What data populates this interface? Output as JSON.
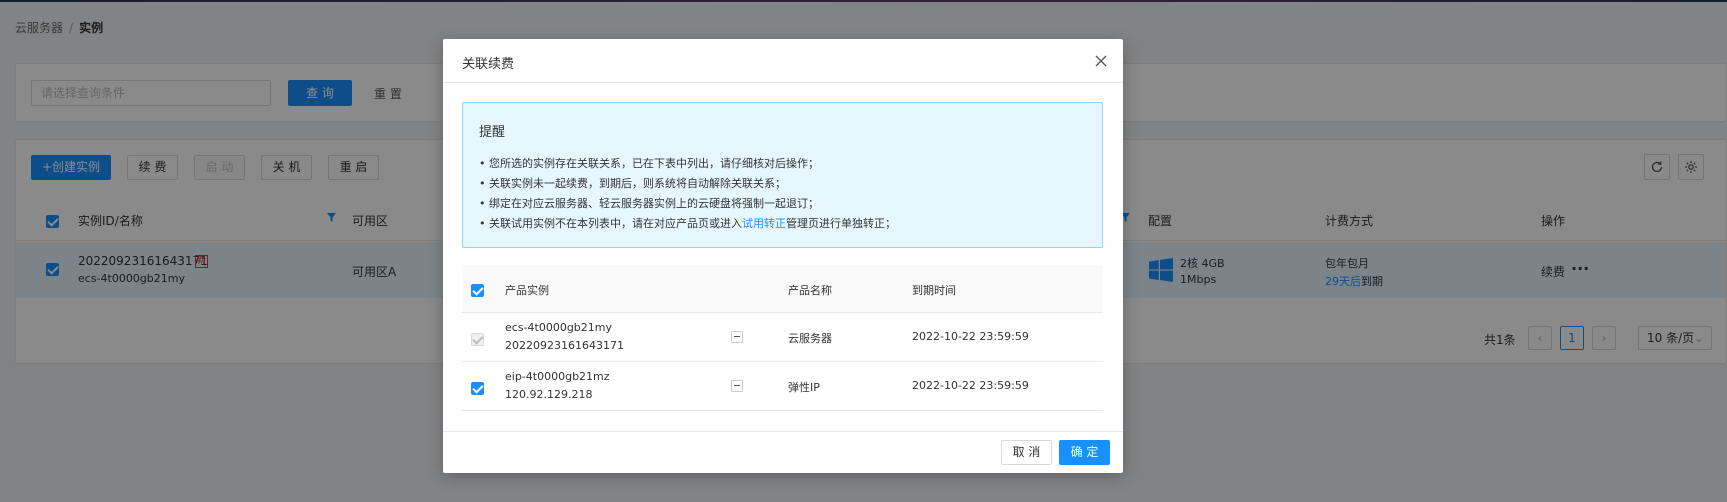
{
  "breadcrumb": {
    "parent": "云服务器",
    "separator": "/",
    "current": "实例"
  },
  "search": {
    "placeholder": "请选择查询条件",
    "query_label": "查 询",
    "reset_label": "重 置"
  },
  "toolbar": {
    "create_label": "+创建实例",
    "renew_label": "续 费",
    "start_label": "启 动",
    "shutdown_label": "关 机",
    "restart_label": "重 启"
  },
  "table": {
    "headers": {
      "id_name": "实例ID/名称",
      "zone": "可用区",
      "config": "配置",
      "billing": "计费方式",
      "action": "操作"
    },
    "row": {
      "id": "20220923161643171",
      "badge": "新",
      "name": "ecs-4t0000gb21my",
      "zone": "可用区A",
      "config_line1": "2核 4GB",
      "config_line2": "1Mbps",
      "billing_line1": "包年包月",
      "billing_days": "29天后",
      "billing_suffix": "到期",
      "action_renew": "续费",
      "action_more": "···"
    }
  },
  "pagination": {
    "total": "共1条",
    "page": "1",
    "page_size": "10 条/页"
  },
  "modal": {
    "title": "关联续费",
    "alert": {
      "title": "提醒",
      "line1": "• 您所选的实例存在关联关系，已在下表中列出，请仔细核对后操作；",
      "line2": "• 关联实例未一起续费，到期后，则系统将自动解除关联关系；",
      "line3": "• 绑定在对应云服务器、轻云服务器实例上的云硬盘将强制一起退订；",
      "line4_before": "• 关联试用实例不在本列表中，请在对应产品页或进入",
      "line4_link": "试用转正",
      "line4_after": "管理页进行单独转正；"
    },
    "table": {
      "headers": {
        "instance": "产品实例",
        "product": "产品名称",
        "expire": "到期时间"
      },
      "rows": [
        {
          "line1": "ecs-4t0000gb21my",
          "line2": "20220923161643171",
          "product": "云服务器",
          "expire": "2022-10-22 23:59:59"
        },
        {
          "line1": "eip-4t0000gb21mz",
          "line2": "120.92.129.218",
          "product": "弹性IP",
          "expire": "2022-10-22 23:59:59"
        }
      ]
    },
    "cancel_label": "取 消",
    "confirm_label": "确 定"
  },
  "colors": {
    "primary": "#1890ff",
    "alert_bg": "#e6f7ff",
    "alert_border": "#91d5ff",
    "badge_red": "#e53935",
    "overlay": "rgba(0,0,0,0.46)"
  }
}
